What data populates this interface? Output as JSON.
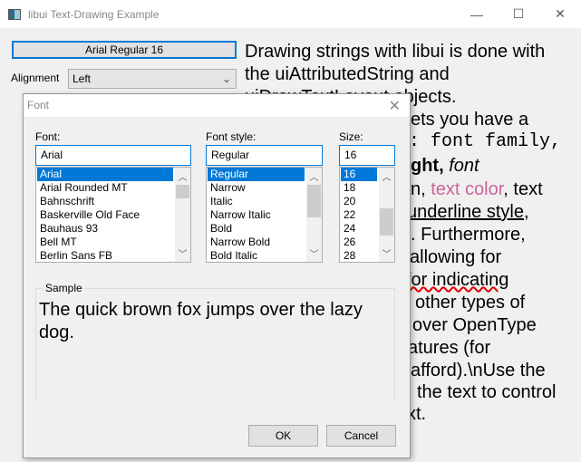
{
  "window": {
    "title": "libui Text-Drawing Example",
    "minimize": "—",
    "maximize": "☐",
    "close": "✕"
  },
  "controls": {
    "font_button": "Arial Regular 16",
    "alignment_label": "Alignment",
    "alignment_value": "Left"
  },
  "drawn_text": {
    "lines": [
      "Drawing strings with libui is done with",
      "the uiAttributedString and",
      "uiDrawTextLayout objects."
    ],
    "fragments": [
      "ets you have a",
      ": font family,",
      "ght, ",
      "font",
      "n, ",
      "text color",
      ", text",
      "underline style",
      ",",
      ". Furthermore,",
      "allowing for",
      "for indicating",
      "other types of",
      "over OpenType",
      "atures (for",
      "afford).\\nUse the",
      "the text to control",
      "xt."
    ],
    "text_color": "#cc6699",
    "squiggle_color": "#e00000"
  },
  "dialog": {
    "title": "Font",
    "close": "✕",
    "font_label": "Font:",
    "font_value": "Arial",
    "fonts": [
      "Arial",
      "Arial Rounded MT",
      "Bahnschrift",
      "Baskerville Old Face",
      "Bauhaus 93",
      "Bell MT",
      "Berlin Sans FB"
    ],
    "style_label": "Font style:",
    "style_value": "Regular",
    "styles": [
      "Regular",
      "Narrow",
      "Italic",
      "Narrow Italic",
      "Bold",
      "Narrow Bold",
      "Bold Italic"
    ],
    "size_label": "Size:",
    "size_value": "16",
    "sizes": [
      "16",
      "18",
      "20",
      "22",
      "24",
      "26",
      "28"
    ],
    "sample_label": "Sample",
    "sample_text": "The quick brown fox jumps over the lazy dog.",
    "ok": "OK",
    "cancel": "Cancel"
  },
  "colors": {
    "accent": "#0078d7"
  }
}
